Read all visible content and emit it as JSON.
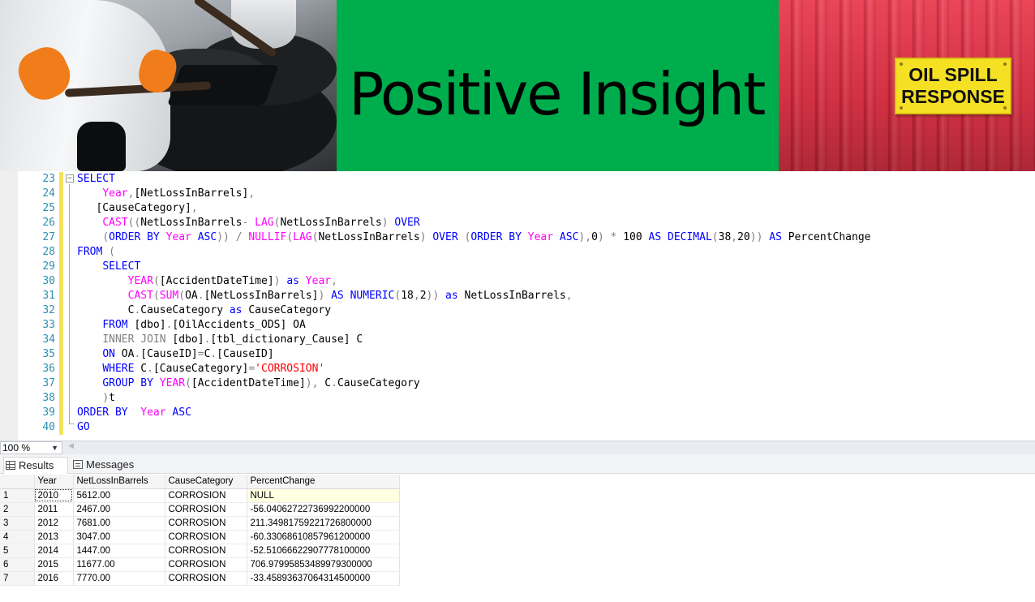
{
  "banner": {
    "title": "Positive Insight",
    "sign": {
      "line1": "OIL SPILL",
      "line2": "RESPONSE"
    },
    "colors": {
      "green_panel": "#00ad4c",
      "red_panel": "#e8364a",
      "sign": "#f6e023"
    }
  },
  "editor": {
    "lines": [
      {
        "no": "23",
        "html": "<span class=\"kw\">SELECT</span>"
      },
      {
        "no": "24",
        "html": "    <span class=\"fn\">Year</span><span class=\"gy\">,</span><span class=\"tx\">[NetLossInBarrels]</span><span class=\"gy\">,</span>"
      },
      {
        "no": "25",
        "html": "   <span class=\"tx\">[CauseCategory]</span><span class=\"gy\">,</span>"
      },
      {
        "no": "26",
        "html": "    <span class=\"fn\">CAST</span><span class=\"gy\">((</span><span class=\"tx\">NetLossInBarrels</span><span class=\"gy\">- </span><span class=\"fn\">LAG</span><span class=\"gy\">(</span><span class=\"tx\">NetLossInBarrels</span><span class=\"gy\">) </span><span class=\"kw\">OVER</span>"
      },
      {
        "no": "27",
        "html": "    <span class=\"gy\">(</span><span class=\"kw\">ORDER BY</span> <span class=\"fn\">Year</span> <span class=\"kw\">ASC</span><span class=\"gy\">)) / </span><span class=\"fn\">NULLIF</span><span class=\"gy\">(</span><span class=\"fn\">LAG</span><span class=\"gy\">(</span><span class=\"tx\">NetLossInBarrels</span><span class=\"gy\">) </span><span class=\"kw\">OVER</span> <span class=\"gy\">(</span><span class=\"kw\">ORDER BY</span> <span class=\"fn\">Year</span> <span class=\"kw\">ASC</span><span class=\"gy\">),</span><span class=\"tx\">0</span><span class=\"gy\">) * </span><span class=\"tx\">100</span> <span class=\"kw\">AS DECIMAL</span><span class=\"gy\">(</span><span class=\"tx\">38</span><span class=\"gy\">,</span><span class=\"tx\">20</span><span class=\"gy\">)) </span><span class=\"kw\">AS</span> <span class=\"tx\">PercentChange</span>"
      },
      {
        "no": "28",
        "html": "<span class=\"kw\">FROM</span> <span class=\"gy\">(</span>"
      },
      {
        "no": "29",
        "html": "    <span class=\"kw\">SELECT</span>"
      },
      {
        "no": "30",
        "html": "        <span class=\"fn\">YEAR</span><span class=\"gy\">(</span><span class=\"tx\">[AccidentDateTime]</span><span class=\"gy\">) </span><span class=\"kw\">as</span> <span class=\"fn\">Year</span><span class=\"gy\">,</span>"
      },
      {
        "no": "31",
        "html": "        <span class=\"fn\">CAST</span><span class=\"gy\">(</span><span class=\"fn\">SUM</span><span class=\"gy\">(</span><span class=\"tx\">OA</span><span class=\"gy\">.</span><span class=\"tx\">[NetLossInBarrels]</span><span class=\"gy\">) </span><span class=\"kw\">AS NUMERIC</span><span class=\"gy\">(</span><span class=\"tx\">18</span><span class=\"gy\">,</span><span class=\"tx\">2</span><span class=\"gy\">)) </span><span class=\"kw\">as</span> <span class=\"tx\">NetLossInBarrels</span><span class=\"gy\">,</span>"
      },
      {
        "no": "32",
        "html": "        <span class=\"tx\">C</span><span class=\"gy\">.</span><span class=\"tx\">CauseCategory</span> <span class=\"kw\">as</span> <span class=\"tx\">CauseCategory</span>"
      },
      {
        "no": "33",
        "html": "    <span class=\"kw\">FROM</span> <span class=\"tx\">[dbo]</span><span class=\"gy\">.</span><span class=\"tx\">[OilAccidents_ODS]</span> <span class=\"tx\">OA</span>"
      },
      {
        "no": "34",
        "html": "    <span class=\"gy\">INNER JOIN</span> <span class=\"tx\">[dbo]</span><span class=\"gy\">.</span><span class=\"tx\">[tbl_dictionary_Cause]</span> <span class=\"tx\">C</span>"
      },
      {
        "no": "35",
        "html": "    <span class=\"kw\">ON</span> <span class=\"tx\">OA</span><span class=\"gy\">.</span><span class=\"tx\">[CauseID]</span><span class=\"gy\">=</span><span class=\"tx\">C</span><span class=\"gy\">.</span><span class=\"tx\">[CauseID]</span>"
      },
      {
        "no": "36",
        "html": "    <span class=\"kw\">WHERE</span> <span class=\"tx\">C</span><span class=\"gy\">.</span><span class=\"tx\">[CauseCategory]</span><span class=\"gy\">=</span><span class=\"st\">'CORROSION'</span>"
      },
      {
        "no": "37",
        "html": "    <span class=\"kw\">GROUP BY</span> <span class=\"fn\">YEAR</span><span class=\"gy\">(</span><span class=\"tx\">[AccidentDateTime]</span><span class=\"gy\">), </span><span class=\"tx\">C</span><span class=\"gy\">.</span><span class=\"tx\">CauseCategory</span>"
      },
      {
        "no": "38",
        "html": "    <span class=\"gy\">)</span><span class=\"tx\">t</span>"
      },
      {
        "no": "39",
        "html": "<span class=\"kw\">ORDER BY</span>  <span class=\"fn\">Year</span> <span class=\"kw\">ASC</span>"
      },
      {
        "no": "40",
        "html": "<span class=\"kw\">GO</span>"
      }
    ]
  },
  "zoom": {
    "value": "100 %"
  },
  "results": {
    "tabs": {
      "results": "Results",
      "messages": "Messages"
    },
    "columns": [
      "",
      "Year",
      "NetLossInBarrels",
      "CauseCategory",
      "PercentChange"
    ],
    "rows": [
      [
        "1",
        "2010",
        "5612.00",
        "CORROSION",
        "NULL"
      ],
      [
        "2",
        "2011",
        "2467.00",
        "CORROSION",
        "-56.04062722736992200000"
      ],
      [
        "3",
        "2012",
        "7681.00",
        "CORROSION",
        "211.34981759221726800000"
      ],
      [
        "4",
        "2013",
        "3047.00",
        "CORROSION",
        "-60.33068610857961200000"
      ],
      [
        "5",
        "2014",
        "1447.00",
        "CORROSION",
        "-52.51066622907778100000"
      ],
      [
        "6",
        "2015",
        "11677.00",
        "CORROSION",
        "706.97995853489979300000"
      ],
      [
        "7",
        "2016",
        "7770.00",
        "CORROSION",
        "-33.45893637064314500000"
      ]
    ]
  }
}
